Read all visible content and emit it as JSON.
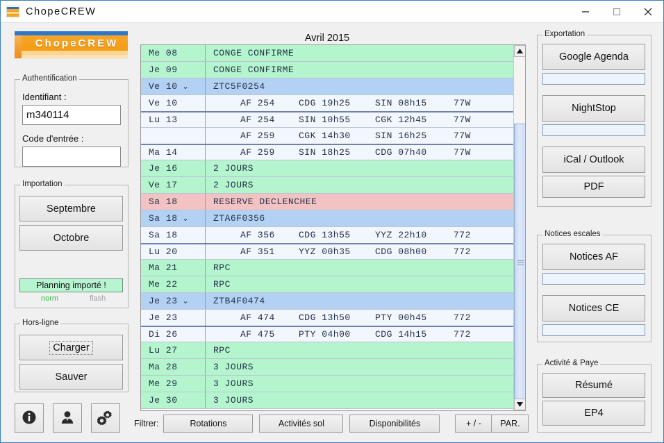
{
  "window": {
    "title": "ChopeCREW",
    "app_icon": "chopecrew-logo-icon",
    "minimize": "minimize-icon",
    "maximize": "maximize-icon",
    "close": "close-icon"
  },
  "logo": {
    "text": "ChopeCREW"
  },
  "auth": {
    "legend": "Authentification",
    "identifiant_label": "Identifiant :",
    "identifiant_value": "m340114",
    "code_label": "Code d'entrée :",
    "code_value": "",
    "code_placeholder": ""
  },
  "importation": {
    "legend": "Importation",
    "buttons": [
      {
        "label": "Septembre"
      },
      {
        "label": "Octobre"
      }
    ],
    "status": "Planning importé !",
    "status_color": "#b4f5ce",
    "norm_label": "norm",
    "norm_color": "#2fbe46",
    "flash_label": "flash",
    "flash_color": "#a0a0a0"
  },
  "offline": {
    "legend": "Hors-ligne",
    "buttons": [
      {
        "label": "Charger",
        "focused": true
      },
      {
        "label": "Sauver",
        "focused": false
      }
    ]
  },
  "tool_icons": [
    {
      "name": "info-icon",
      "glyph": "i"
    },
    {
      "name": "user-icon",
      "glyph": "user"
    },
    {
      "name": "settings-gears-icon",
      "glyph": "gears"
    }
  ],
  "schedule": {
    "month_title": "Avril 2015",
    "rows": [
      {
        "date": "Me 08",
        "chevron": false,
        "type": "green",
        "text": "CONGE CONFIRME"
      },
      {
        "date": "Je 09",
        "chevron": false,
        "type": "green",
        "text": "CONGE CONFIRME"
      },
      {
        "date": "Ve 10",
        "chevron": true,
        "type": "blue",
        "text": "ZTC5F0254"
      },
      {
        "date": "Ve 10",
        "chevron": false,
        "type": "white",
        "flight": "AF 254",
        "dep": "CDG 19h25",
        "arr": "SIN 08h15",
        "eqp": "77W"
      },
      {
        "date": "Lu 13",
        "chevron": false,
        "type": "white",
        "sep": true,
        "flight": "AF 254",
        "dep": "SIN 10h55",
        "arr": "CGK 12h45",
        "eqp": "77W"
      },
      {
        "date": "",
        "chevron": false,
        "type": "white",
        "flight": "AF 259",
        "dep": "CGK 14h30",
        "arr": "SIN 16h25",
        "eqp": "77W"
      },
      {
        "date": "Ma 14",
        "chevron": false,
        "type": "white",
        "sep": true,
        "flight": "AF 259",
        "dep": "SIN 18h25",
        "arr": "CDG 07h40",
        "eqp": "77W"
      },
      {
        "date": "Je 16",
        "chevron": false,
        "type": "green",
        "text": "2 JOURS"
      },
      {
        "date": "Ve 17",
        "chevron": false,
        "type": "green",
        "text": "2 JOURS"
      },
      {
        "date": "Sa 18",
        "chevron": false,
        "type": "pink",
        "text": "RESERVE DECLENCHEE"
      },
      {
        "date": "Sa 18",
        "chevron": true,
        "type": "blue",
        "text": "ZTA6F0356"
      },
      {
        "date": "Sa 18",
        "chevron": false,
        "type": "white",
        "flight": "AF 356",
        "dep": "CDG 13h55",
        "arr": "YYZ 22h10",
        "eqp": "772"
      },
      {
        "date": "Lu 20",
        "chevron": false,
        "type": "white",
        "sep": true,
        "flight": "AF 351",
        "dep": "YYZ 00h35",
        "arr": "CDG 08h00",
        "eqp": "772"
      },
      {
        "date": "Ma 21",
        "chevron": false,
        "type": "green",
        "text": "RPC"
      },
      {
        "date": "Me 22",
        "chevron": false,
        "type": "green",
        "text": "RPC"
      },
      {
        "date": "Je 23",
        "chevron": true,
        "type": "blue",
        "text": "ZTB4F0474"
      },
      {
        "date": "Je 23",
        "chevron": false,
        "type": "white",
        "flight": "AF 474",
        "dep": "CDG 13h50",
        "arr": "PTY 00h45",
        "eqp": "772"
      },
      {
        "date": "Di 26",
        "chevron": false,
        "type": "white",
        "sep": true,
        "flight": "AF 475",
        "dep": "PTY 04h00",
        "arr": "CDG 14h15",
        "eqp": "772"
      },
      {
        "date": "Lu 27",
        "chevron": false,
        "type": "green",
        "text": "RPC"
      },
      {
        "date": "Ma 28",
        "chevron": false,
        "type": "green",
        "text": "3 JOURS"
      },
      {
        "date": "Me 29",
        "chevron": false,
        "type": "green",
        "text": "3 JOURS"
      },
      {
        "date": "Je 30",
        "chevron": false,
        "type": "green",
        "text": "3 JOURS"
      }
    ]
  },
  "scrollbar": {
    "up": "scroll-up-arrow-icon",
    "down": "scroll-down-arrow-icon"
  },
  "filter": {
    "label": "Filtrer:",
    "buttons": [
      {
        "label": "Rotations"
      },
      {
        "label": "Activités sol"
      },
      {
        "label": "Disponibilités"
      },
      {
        "label": "+ / -"
      },
      {
        "label": "PAR."
      }
    ]
  },
  "exportation": {
    "legend": "Exportation",
    "buttons": [
      {
        "label": "Google Agenda",
        "progress": true
      },
      {
        "label": "NightStop",
        "progress": true
      },
      {
        "label": "iCal / Outlook",
        "progress": false
      },
      {
        "label": "PDF",
        "progress": false
      }
    ]
  },
  "notices": {
    "legend": "Notices escales",
    "buttons": [
      {
        "label": "Notices AF",
        "progress": true
      },
      {
        "label": "Notices CE",
        "progress": true
      }
    ]
  },
  "pay": {
    "legend": "Activité & Paye",
    "buttons": [
      {
        "label": "Résumé"
      },
      {
        "label": "EP4"
      }
    ]
  },
  "colors": {
    "leave": "#b4f5ce",
    "rotation": "#b3d1f3",
    "flight": "#f2f6fd",
    "reserve": "#f3c3c3",
    "titlebar_border": "#3a7fbf"
  }
}
